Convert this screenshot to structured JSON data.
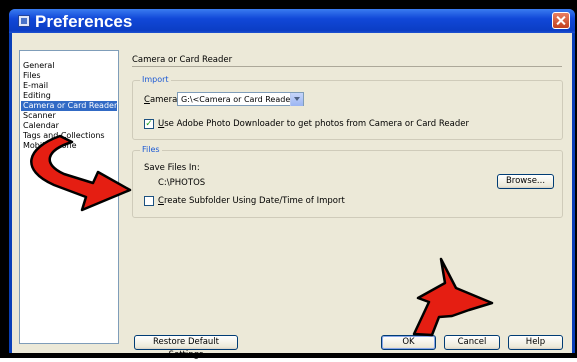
{
  "window": {
    "title": "Preferences"
  },
  "nav": {
    "items": [
      "General",
      "Files",
      "E-mail",
      "Editing",
      "Camera or Card Reader",
      "Scanner",
      "Calendar",
      "Tags and Collections",
      "Mobile Phone"
    ],
    "selected_index": 4
  },
  "panel": {
    "title": "Camera or Card Reader"
  },
  "import": {
    "label": "Import",
    "camera_label_u": "C",
    "camera_label_rest": "amera:",
    "camera_value": "G:\\<Camera or Card Reader>",
    "downloader_checked": true,
    "downloader_label_u": "U",
    "downloader_label_rest": "se Adobe Photo Downloader to get photos from Camera or Card Reader"
  },
  "files": {
    "label": "Files",
    "save_label": "Save Files In:",
    "save_path": "C:\\PHOTOS",
    "browse_label": "Browse...",
    "subfolder_checked": false,
    "subfolder_label_u": "C",
    "subfolder_label_rest": "reate Subfolder Using Date/Time of Import"
  },
  "buttons": {
    "restore": "Restore Default Settings",
    "ok": "OK",
    "cancel": "Cancel",
    "help": "Help"
  },
  "colors": {
    "annotation_arrow": "#e51e12",
    "title_bar": "#0b3dc4",
    "selection": "#316ac5"
  }
}
